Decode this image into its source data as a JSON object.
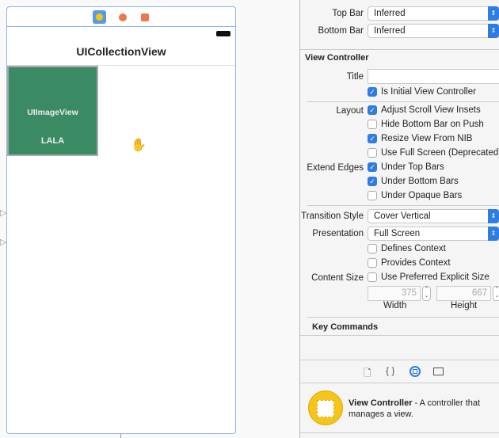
{
  "scene": {
    "title": "UICollectionView",
    "cell_image_label": "UIImageView",
    "cell_label": "LALA",
    "icons": [
      "view-controller-icon",
      "first-responder-icon",
      "exit-icon"
    ]
  },
  "inspector": {
    "top_bar": {
      "label": "Top Bar",
      "value": "Inferred"
    },
    "bottom_bar": {
      "label": "Bottom Bar",
      "value": "Inferred"
    },
    "section_title": "View Controller",
    "title_label": "Title",
    "title_value": "",
    "is_initial": {
      "label": "Is Initial View Controller",
      "checked": true
    },
    "layout_label": "Layout",
    "layout": [
      {
        "label": "Adjust Scroll View Insets",
        "checked": true
      },
      {
        "label": "Hide Bottom Bar on Push",
        "checked": false
      },
      {
        "label": "Resize View From NIB",
        "checked": true
      },
      {
        "label": "Use Full Screen (Deprecated)",
        "checked": false
      }
    ],
    "extend_label": "Extend Edges",
    "extend": [
      {
        "label": "Under Top Bars",
        "checked": true
      },
      {
        "label": "Under Bottom Bars",
        "checked": true
      },
      {
        "label": "Under Opaque Bars",
        "checked": false
      }
    ],
    "transition": {
      "label": "Transition Style",
      "value": "Cover Vertical"
    },
    "presentation": {
      "label": "Presentation",
      "value": "Full Screen"
    },
    "defines_context": {
      "label": "Defines Context",
      "checked": false
    },
    "provides_context": {
      "label": "Provides Context",
      "checked": false
    },
    "content_size_label": "Content Size",
    "preferred_size": {
      "label": "Use Preferred Explicit Size",
      "checked": false
    },
    "width": {
      "value": "375",
      "label": "Width"
    },
    "height": {
      "value": "667",
      "label": "Height"
    },
    "key_commands": "Key Commands"
  },
  "library": {
    "tabs": [
      "file-icon",
      "braces-icon",
      "object-icon",
      "media-icon"
    ],
    "selected_tab": "object-icon",
    "item_title": "View Controller",
    "item_desc": " - A controller that manages a view."
  },
  "colors": {
    "accent": "#2f7de1",
    "cell": "#3a8a63",
    "library_icon": "#f5c518"
  }
}
